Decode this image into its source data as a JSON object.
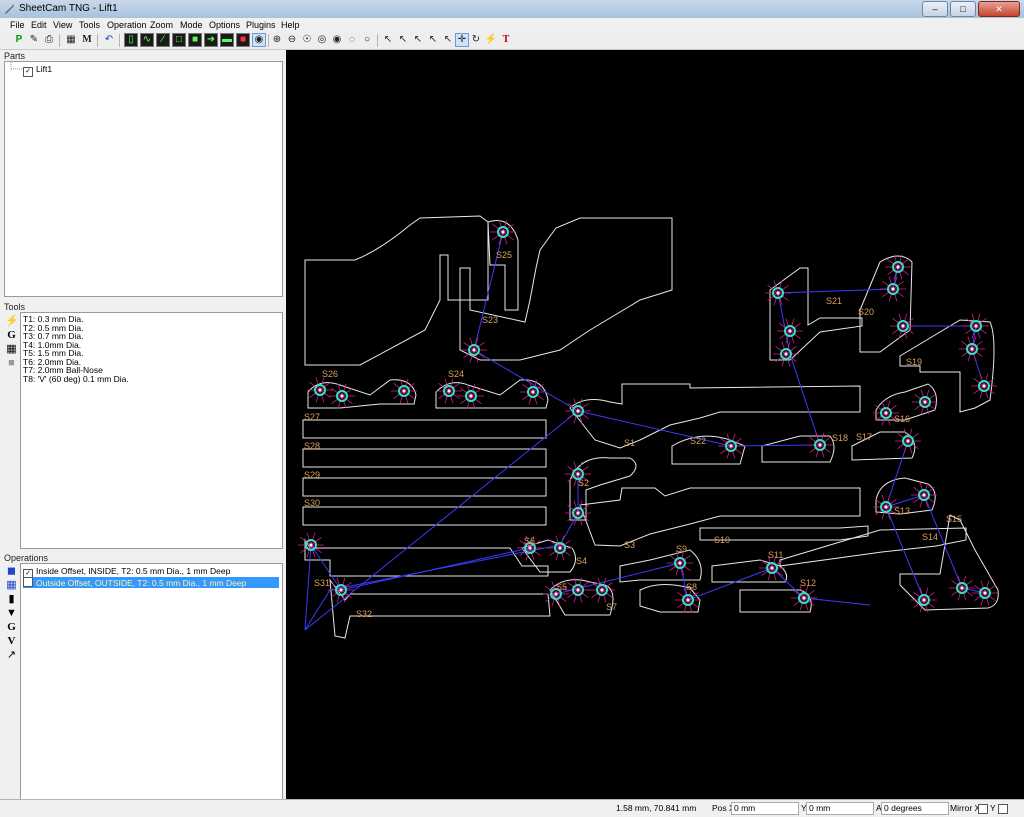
{
  "window": {
    "title": "SheetCam TNG - Lift1"
  },
  "menu": [
    "File",
    "Edit",
    "View",
    "Tools",
    "Operation",
    "Zoom",
    "Mode",
    "Options",
    "Plugins",
    "Help"
  ],
  "parts": {
    "label": "Parts",
    "items": [
      {
        "name": "Lift1",
        "checked": true
      }
    ]
  },
  "tools": {
    "label": "Tools",
    "items": [
      "T1: 0.3 mm Dia.",
      "T2: 0.5 mm Dia.",
      "T3: 0.7 mm Dia.",
      "T4: 1.0mm Dia.",
      "T5: 1.5 mm Dia.",
      "T6: 2.0mm Dia.",
      "T7: 2.0mm Ball-Nose",
      "T8: 'V' (60 deg) 0.1 mm Dia."
    ]
  },
  "operations": {
    "label": "Operations",
    "items": [
      {
        "text": "Inside Offset, INSIDE, T2: 0.5 mm Dia., 1 mm Deep",
        "checked": true,
        "selected": false
      },
      {
        "text": "Outside Offset, OUTSIDE, T2: 0.5 mm Dia., 1 mm Deep",
        "checked": false,
        "selected": true
      }
    ]
  },
  "canvas": {
    "labels": [
      "S1",
      "S2",
      "S3",
      "S4",
      "S5",
      "S6",
      "S7",
      "S8",
      "S9",
      "S10",
      "S11",
      "S12",
      "S13",
      "S14",
      "S15",
      "S16",
      "S17",
      "S18",
      "S19",
      "S20",
      "S21",
      "S22",
      "S23",
      "S24",
      "S25",
      "S26",
      "S27",
      "S28",
      "S29",
      "S30",
      "S31",
      "S32"
    ],
    "colors": {
      "outline": "#e8e8e8",
      "path": "#3a3aff",
      "label": "#d9a05b",
      "hole": "#33e0c0",
      "pierce": "#d0208a"
    }
  },
  "status": {
    "coords": "1.58 mm, 70.841 mm",
    "posx_label": "Pos X",
    "posx_value": "0 mm",
    "y_label": "Y",
    "y_value": "0 mm",
    "a_label": "A",
    "a_value": "0 degrees",
    "mirrorx_label": "Mirror X",
    "y2_label": "Y"
  }
}
